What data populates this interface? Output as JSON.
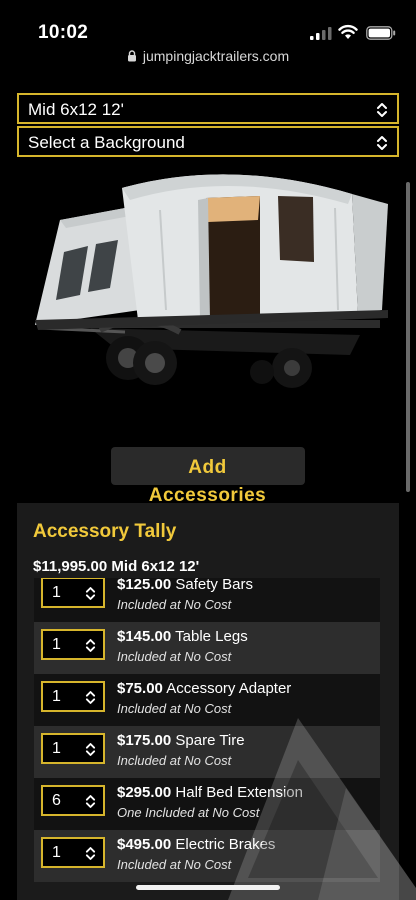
{
  "status_bar": {
    "time": "10:02"
  },
  "browser": {
    "url": "jumpingjacktrailers.com"
  },
  "model_select": {
    "value": "Mid 6x12 12'"
  },
  "background_select": {
    "value": "Select a Background"
  },
  "add_accessories": {
    "line1": "Add",
    "line2": "Accessories"
  },
  "tally": {
    "title": "Accessory Tally",
    "base_price": "$11,995.00",
    "base_model": "Mid 6x12 12'",
    "items": [
      {
        "qty": "1",
        "price": "$125.00",
        "name": "Safety Bars",
        "note": "Included at No Cost"
      },
      {
        "qty": "1",
        "price": "$145.00",
        "name": "Table Legs",
        "note": "Included at No Cost"
      },
      {
        "qty": "1",
        "price": "$75.00",
        "name": "Accessory Adapter",
        "note": "Included at No Cost"
      },
      {
        "qty": "1",
        "price": "$175.00",
        "name": "Spare Tire",
        "note": "Included at No Cost"
      },
      {
        "qty": "6",
        "price": "$295.00",
        "name": "Half Bed Extension",
        "note": "One Included at No Cost"
      },
      {
        "qty": "1",
        "price": "$495.00",
        "name": "Electric Brakes",
        "note": "Included at No Cost"
      }
    ]
  },
  "colors": {
    "accent": "#f1c93b",
    "border": "#d6b52c",
    "panel": "#1b1b1b"
  },
  "icons": [
    "signal-icon",
    "wifi-icon",
    "battery-icon",
    "lock-icon",
    "chevron-updown-icon",
    "watermark-logo"
  ]
}
